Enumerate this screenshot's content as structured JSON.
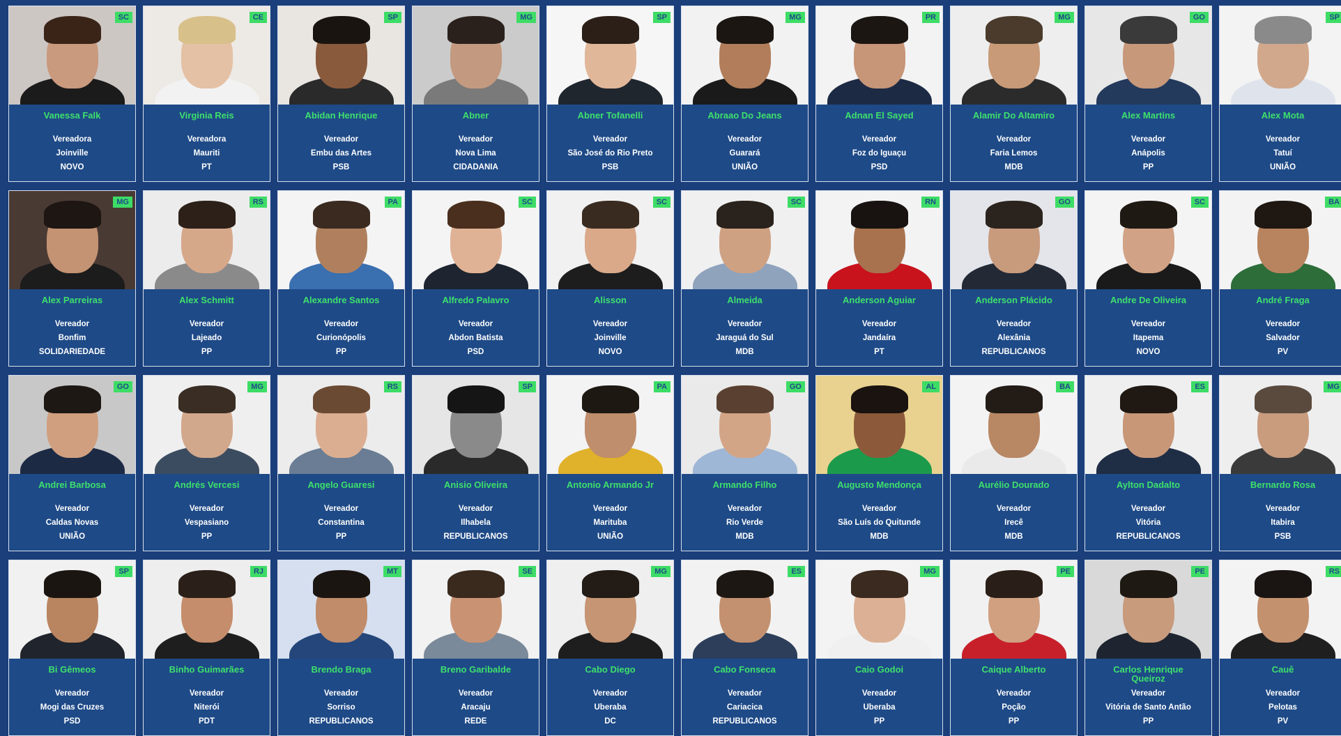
{
  "cards": [
    {
      "state": "SC",
      "name": "Vanessa Falk",
      "role": "Vereadora",
      "city": "Joinville",
      "party": "NOVO",
      "bg": "#cdc7c4",
      "skin": "#c99a7e",
      "hair": "#3a2418",
      "shirt": "#1b1b1b"
    },
    {
      "state": "CE",
      "name": "Virginia Reis",
      "role": "Vereadora",
      "city": "Mauriti",
      "party": "PT",
      "bg": "#ede9e4",
      "skin": "#e4c0a4",
      "hair": "#d8c08a",
      "shirt": "#f2f2f2"
    },
    {
      "state": "SP",
      "name": "Abidan Henrique",
      "role": "Vereador",
      "city": "Embu das Artes",
      "party": "PSB",
      "bg": "#e9e5e1",
      "skin": "#8a5a3c",
      "hair": "#1a1410",
      "shirt": "#2a2a2a"
    },
    {
      "state": "MG",
      "name": "Abner",
      "role": "Vereador",
      "city": "Nova Lima",
      "party": "CIDADANIA",
      "bg": "#cbcbcb",
      "skin": "#c39a80",
      "hair": "#2a211c",
      "shirt": "#7a7a7a"
    },
    {
      "state": "SP",
      "name": "Abner Tofanelli",
      "role": "Vereador",
      "city": "São José do Rio Preto",
      "party": "PSB",
      "bg": "#f6f6f6",
      "skin": "#e1b79a",
      "hair": "#2b1f18",
      "shirt": "#20262e"
    },
    {
      "state": "MG",
      "name": "Abraao Do Jeans",
      "role": "Vereador",
      "city": "Guarará",
      "party": "UNIÃO",
      "bg": "#f2f2f2",
      "skin": "#b27d5a",
      "hair": "#1c1612",
      "shirt": "#1a1a1a"
    },
    {
      "state": "PR",
      "name": "Adnan El Sayed",
      "role": "Vereador",
      "city": "Foz do Iguaçu",
      "party": "PSD",
      "bg": "#f3f3f3",
      "skin": "#c79577",
      "hair": "#1b1612",
      "shirt": "#1d2a44"
    },
    {
      "state": "MG",
      "name": "Alamir Do Altamiro",
      "role": "Vereador",
      "city": "Faria Lemos",
      "party": "MDB",
      "bg": "#eeeeee",
      "skin": "#c89a78",
      "hair": "#4a3b2c",
      "shirt": "#2b2b2b"
    },
    {
      "state": "GO",
      "name": "Alex Martins",
      "role": "Vereador",
      "city": "Anápolis",
      "party": "PP",
      "bg": "#e7e7e7",
      "skin": "#c7987a",
      "hair": "#3a3a3a",
      "shirt": "#233a5c"
    },
    {
      "state": "SP",
      "name": "Alex Mota",
      "role": "Vereador",
      "city": "Tatuí",
      "party": "UNIÃO",
      "bg": "#f3f3f3",
      "skin": "#d2a88c",
      "hair": "#8a8a8a",
      "shirt": "#dfe4ec"
    },
    {
      "state": "MG",
      "name": "Alex Parreiras",
      "role": "Vereador",
      "city": "Bonfim",
      "party": "SOLIDARIEDADE",
      "bg": "#4a3a34",
      "skin": "#c49373",
      "hair": "#1d1612",
      "shirt": "#1c1c1c"
    },
    {
      "state": "RS",
      "name": "Alex Schmitt",
      "role": "Vereador",
      "city": "Lajeado",
      "party": "PP",
      "bg": "#ececec",
      "skin": "#d6a88a",
      "hair": "#2c2018",
      "shirt": "#8a8a8a"
    },
    {
      "state": "PA",
      "name": "Alexandre Santos",
      "role": "Vereador",
      "city": "Curionópolis",
      "party": "PP",
      "bg": "#f4f4f4",
      "skin": "#b0805e",
      "hair": "#3a2a20",
      "shirt": "#3a6fb0"
    },
    {
      "state": "SC",
      "name": "Alfredo Palavro",
      "role": "Vereador",
      "city": "Abdon Batista",
      "party": "PSD",
      "bg": "#f4f4f4",
      "skin": "#e0b295",
      "hair": "#4a2e1e",
      "shirt": "#1e2530"
    },
    {
      "state": "SC",
      "name": "Alisson",
      "role": "Vereador",
      "city": "Joinville",
      "party": "NOVO",
      "bg": "#f1f1f1",
      "skin": "#d9a98a",
      "hair": "#3a2b20",
      "shirt": "#1d1d1d"
    },
    {
      "state": "SC",
      "name": "Almeida",
      "role": "Vereador",
      "city": "Jaraguá do Sul",
      "party": "MDB",
      "bg": "#f0f0f0",
      "skin": "#cfa183",
      "hair": "#2a221c",
      "shirt": "#8fa3bd"
    },
    {
      "state": "RN",
      "name": "Anderson Aguiar",
      "role": "Vereador",
      "city": "Jandaíra",
      "party": "PT",
      "bg": "#f3f3f3",
      "skin": "#a8724f",
      "hair": "#181311",
      "shirt": "#c8121c"
    },
    {
      "state": "GO",
      "name": "Anderson Plácido",
      "role": "Vereador",
      "city": "Alexânia",
      "party": "REPUBLICANOS",
      "bg": "#e4e5ea",
      "skin": "#c89b7d",
      "hair": "#2b231d",
      "shirt": "#232a36"
    },
    {
      "state": "SC",
      "name": "Andre De Oliveira",
      "role": "Vereador",
      "city": "Itapema",
      "party": "NOVO",
      "bg": "#f4f4f4",
      "skin": "#d1a285",
      "hair": "#1f1914",
      "shirt": "#1a1a1a"
    },
    {
      "state": "BA",
      "name": "André Fraga",
      "role": "Vereador",
      "city": "Salvador",
      "party": "PV",
      "bg": "#f3f3f3",
      "skin": "#b8845f",
      "hair": "#1e1712",
      "shirt": "#2c6d3a"
    },
    {
      "state": "GO",
      "name": "Andrei Barbosa",
      "role": "Vereador",
      "city": "Caldas Novas",
      "party": "UNIÃO",
      "bg": "#c8c8c8",
      "skin": "#d09f80",
      "hair": "#1e1814",
      "shirt": "#1c2a44"
    },
    {
      "state": "MG",
      "name": "Andrés Vercesi",
      "role": "Vereador",
      "city": "Vespasiano",
      "party": "PP",
      "bg": "#efefef",
      "skin": "#d2a88c",
      "hair": "#3a2d24",
      "shirt": "#3c4c60"
    },
    {
      "state": "RS",
      "name": "Angelo Guaresi",
      "role": "Vereador",
      "city": "Constantina",
      "party": "PP",
      "bg": "#ececec",
      "skin": "#dcae91",
      "hair": "#6a4a32",
      "shirt": "#6a7d94"
    },
    {
      "state": "SP",
      "name": "Anisio Oliveira",
      "role": "Vereador",
      "city": "Ilhabela",
      "party": "REPUBLICANOS",
      "bg": "#e6e6e6",
      "skin": "#8a8a8a",
      "hair": "#151515",
      "shirt": "#2a2a2a"
    },
    {
      "state": "PA",
      "name": "Antonio Armando Jr",
      "role": "Vereador",
      "city": "Marituba",
      "party": "UNIÃO",
      "bg": "#f3f3f3",
      "skin": "#bf8e6c",
      "hair": "#1e1813",
      "shirt": "#e0b12a"
    },
    {
      "state": "GO",
      "name": "Armando Filho",
      "role": "Vereador",
      "city": "Rio Verde",
      "party": "MDB",
      "bg": "#eaeaea",
      "skin": "#d3a587",
      "hair": "#5a4030",
      "shirt": "#9fb7d6"
    },
    {
      "state": "AL",
      "name": "Augusto Mendonça",
      "role": "Vereador",
      "city": "São Luís do Quitunde",
      "party": "MDB",
      "bg": "#e9d28f",
      "skin": "#8c5a3a",
      "hair": "#1a1310",
      "shirt": "#1c9a4c"
    },
    {
      "state": "BA",
      "name": "Aurélio Dourado",
      "role": "Vereador",
      "city": "Irecê",
      "party": "MDB",
      "bg": "#f3f3f3",
      "skin": "#b88763",
      "hair": "#231b16",
      "shirt": "#eaeaea"
    },
    {
      "state": "ES",
      "name": "Aylton Dadalto",
      "role": "Vereador",
      "city": "Vitória",
      "party": "REPUBLICANOS",
      "bg": "#efefef",
      "skin": "#c89778",
      "hair": "#1f1813",
      "shirt": "#1f2d45"
    },
    {
      "state": "MG",
      "name": "Bernardo Rosa",
      "role": "Vereador",
      "city": "Itabira",
      "party": "PSB",
      "bg": "#eeeeee",
      "skin": "#c99c7e",
      "hair": "#5a4a3e",
      "shirt": "#3a3a3a"
    },
    {
      "state": "SP",
      "name": "Bi Gêmeos",
      "role": "Vereador",
      "city": "Mogi das Cruzes",
      "party": "PSD",
      "bg": "#f1f1f1",
      "skin": "#b98561",
      "hair": "#1b1512",
      "shirt": "#20242c"
    },
    {
      "state": "RJ",
      "name": "Binho Guimarães",
      "role": "Vereador",
      "city": "Niterói",
      "party": "PDT",
      "bg": "#eeeeee",
      "skin": "#c58d6b",
      "hair": "#2b2019",
      "shirt": "#1e1e1e"
    },
    {
      "state": "MT",
      "name": "Brendo Braga",
      "role": "Vereador",
      "city": "Sorriso",
      "party": "REPUBLICANOS",
      "bg": "#d6dff0",
      "skin": "#c08c6a",
      "hair": "#1b1512",
      "shirt": "#24467a"
    },
    {
      "state": "SE",
      "name": "Breno Garibalde",
      "role": "Vereador",
      "city": "Aracaju",
      "party": "REDE",
      "bg": "#f2f2f2",
      "skin": "#c99373",
      "hair": "#3a2a1e",
      "shirt": "#7a8a9a"
    },
    {
      "state": "MG",
      "name": "Cabo Diego",
      "role": "Vereador",
      "city": "Uberaba",
      "party": "DC",
      "bg": "#efefef",
      "skin": "#c69574",
      "hair": "#221b16",
      "shirt": "#1e1e1e"
    },
    {
      "state": "ES",
      "name": "Cabo Fonseca",
      "role": "Vereador",
      "city": "Cariacica",
      "party": "REPUBLICANOS",
      "bg": "#f2f2f2",
      "skin": "#c39170",
      "hair": "#1d1713",
      "shirt": "#2c3e5a"
    },
    {
      "state": "MG",
      "name": "Caio Godoi",
      "role": "Vereador",
      "city": "Uberaba",
      "party": "PP",
      "bg": "#f3f3f3",
      "skin": "#dcb094",
      "hair": "#3a2a20",
      "shirt": "#f0f0f0"
    },
    {
      "state": "PE",
      "name": "Caique Alberto",
      "role": "Vereador",
      "city": "Poção",
      "party": "PP",
      "bg": "#f1f1f1",
      "skin": "#d0a081",
      "hair": "#2a1f18",
      "shirt": "#c8202a"
    },
    {
      "state": "PE",
      "name": "Carlos Henrique Queiroz",
      "role": "Vereador",
      "city": "Vitória de Santo Antão",
      "party": "PP",
      "bg": "#d9d9d9",
      "skin": "#c89b7d",
      "hair": "#1f1914",
      "shirt": "#1e2530"
    },
    {
      "state": "RS",
      "name": "Cauê",
      "role": "Vereador",
      "city": "Pelotas",
      "party": "PV",
      "bg": "#f3f3f3",
      "skin": "#c4916f",
      "hair": "#1a1512",
      "shirt": "#1f1f1f"
    }
  ]
}
